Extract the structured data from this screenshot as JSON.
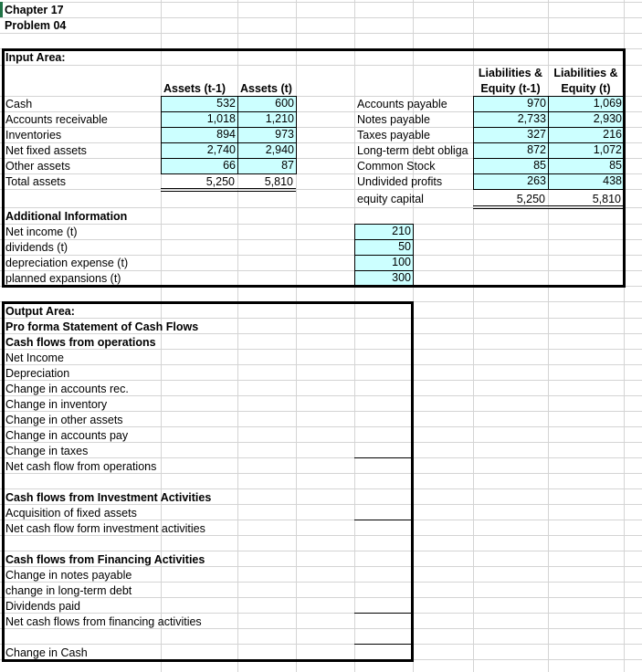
{
  "sheet": {
    "title_line1": "Chapter 17",
    "title_line2": "Problem 04"
  },
  "input_area": {
    "label": "Input Area:",
    "assets_headers": [
      "Assets  (t-1)",
      "Assets  (t)"
    ],
    "liab_headers": [
      {
        "line1": "Liabilities &",
        "line2": "Equity (t-1)"
      },
      {
        "line1": "Liabilities &",
        "line2": "Equity (t)"
      }
    ],
    "assets": [
      {
        "label": "Cash",
        "t_minus_1": "532",
        "t": "600"
      },
      {
        "label": "Accounts receivable",
        "t_minus_1": "1,018",
        "t": "1,210"
      },
      {
        "label": "Inventories",
        "t_minus_1": "894",
        "t": "973"
      },
      {
        "label": "Net fixed assets",
        "t_minus_1": "2,740",
        "t": "2,940"
      },
      {
        "label": "Other assets",
        "t_minus_1": "66",
        "t": "87"
      }
    ],
    "total_assets": {
      "label": "Total assets",
      "t_minus_1": "5,250",
      "t": "5,810"
    },
    "liabilities": [
      {
        "label": "Accounts payable",
        "t_minus_1": "970",
        "t": "1,069"
      },
      {
        "label": "Notes payable",
        "t_minus_1": "2,733",
        "t": "2,930"
      },
      {
        "label": "Taxes payable",
        "t_minus_1": "327",
        "t": "216"
      },
      {
        "label": "Long-term debt obliga",
        "t_minus_1": "872",
        "t": "1,072"
      },
      {
        "label": "Common Stock",
        "t_minus_1": "85",
        "t": "85"
      },
      {
        "label": "Undivided profits",
        "t_minus_1": "263",
        "t": "438"
      }
    ],
    "equity_capital": {
      "label": "equity capital",
      "t_minus_1": "5,250",
      "t": "5,810"
    },
    "additional": {
      "label": "Additional Information",
      "items": [
        {
          "label": "Net income (t)",
          "value": "210"
        },
        {
          "label": "dividends (t)",
          "value": "50"
        },
        {
          "label": "depreciation expense (t)",
          "value": "100"
        },
        {
          "label": "planned expansions (t)",
          "value": "300"
        }
      ]
    }
  },
  "output_area": {
    "label": "Output Area:",
    "statement_title": "Pro forma Statement of Cash Flows",
    "operations": {
      "heading": "Cash flows from operations",
      "items": [
        "Net Income",
        "Depreciation",
        "Change in accounts rec.",
        "Change in inventory",
        "Change in other assets",
        "Change in accounts pay",
        "Change in taxes"
      ],
      "total": "Net cash flow from operations"
    },
    "investment": {
      "heading": "Cash flows from Investment Activities",
      "items": [
        "Acquisition of fixed assets"
      ],
      "total": "Net cash flow form investment activities"
    },
    "financing": {
      "heading": "Cash flows from Financing Activities",
      "items": [
        "Change in notes payable",
        "change in long-term debt",
        "Dividends paid"
      ],
      "total": "Net cash flows from financing activities"
    },
    "change_in_cash": "Change in Cash"
  },
  "colors": {
    "input_fill": "#ccffff",
    "gridline": "#d4d4d4",
    "selection": "#217346"
  }
}
